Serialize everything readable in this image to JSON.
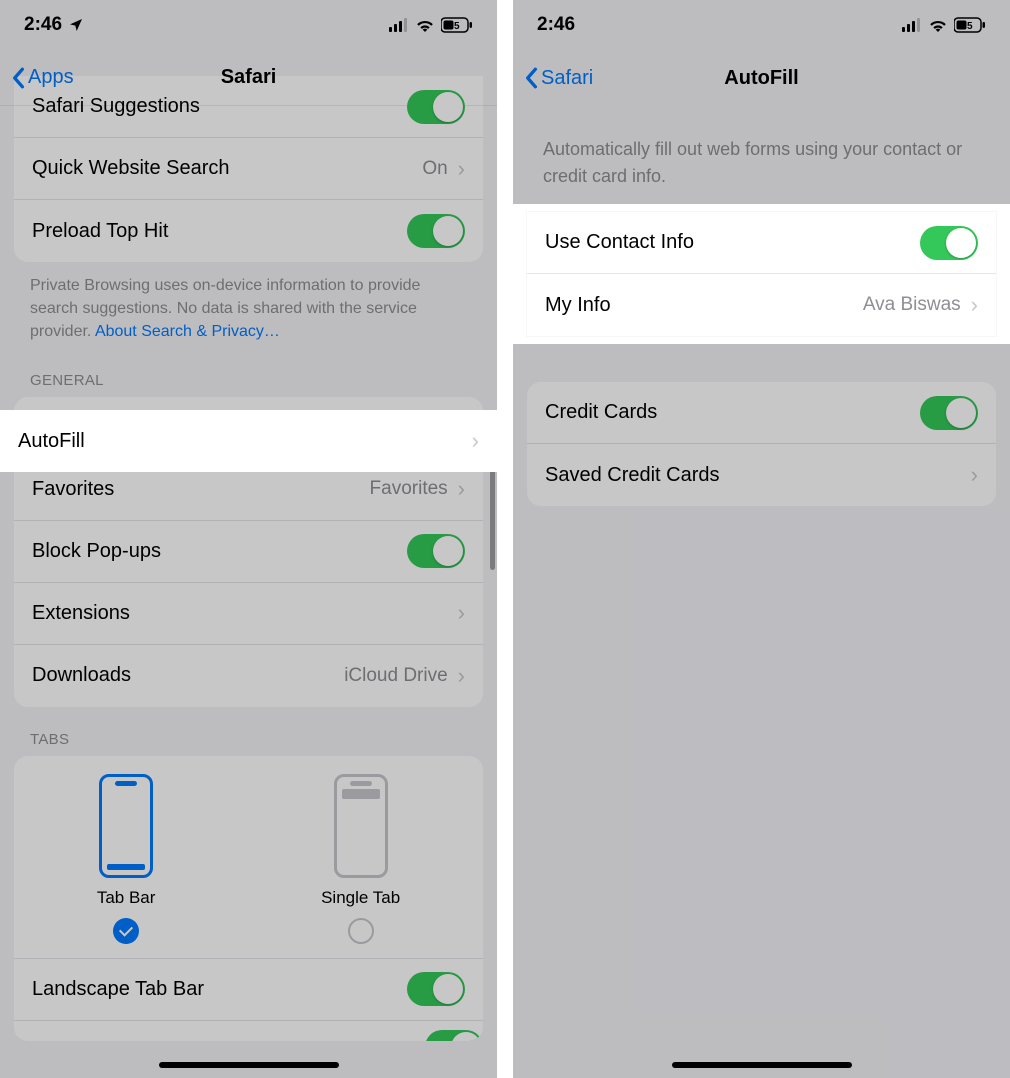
{
  "status": {
    "time": "2:46",
    "battery": "5"
  },
  "left": {
    "nav": {
      "back": "Apps",
      "title": "Safari"
    },
    "rows": {
      "safari_suggestions": "Safari Suggestions",
      "quick_website_search": "Quick Website Search",
      "quick_website_search_value": "On",
      "preload_top_hit": "Preload Top Hit"
    },
    "private_browsing_footer": "Private Browsing uses on-device information to provide search suggestions. No data is shared with the service provider. ",
    "privacy_link": "About Search & Privacy…",
    "headers": {
      "general": "GENERAL",
      "tabs": "TABS"
    },
    "general": {
      "autofill": "AutoFill",
      "favorites": "Favorites",
      "favorites_value": "Favorites",
      "block_popups": "Block Pop-ups",
      "extensions": "Extensions",
      "downloads": "Downloads",
      "downloads_value": "iCloud Drive"
    },
    "tabs": {
      "tab_bar": "Tab Bar",
      "single_tab": "Single Tab",
      "landscape": "Landscape Tab Bar"
    }
  },
  "right": {
    "nav": {
      "back": "Safari",
      "title": "AutoFill"
    },
    "desc": "Automatically fill out web forms using your contact or credit card info.",
    "contact": {
      "use_contact_info": "Use Contact Info",
      "my_info": "My Info",
      "my_info_value": "Ava Biswas"
    },
    "cards": {
      "credit_cards": "Credit Cards",
      "saved_credit_cards": "Saved Credit Cards"
    }
  }
}
